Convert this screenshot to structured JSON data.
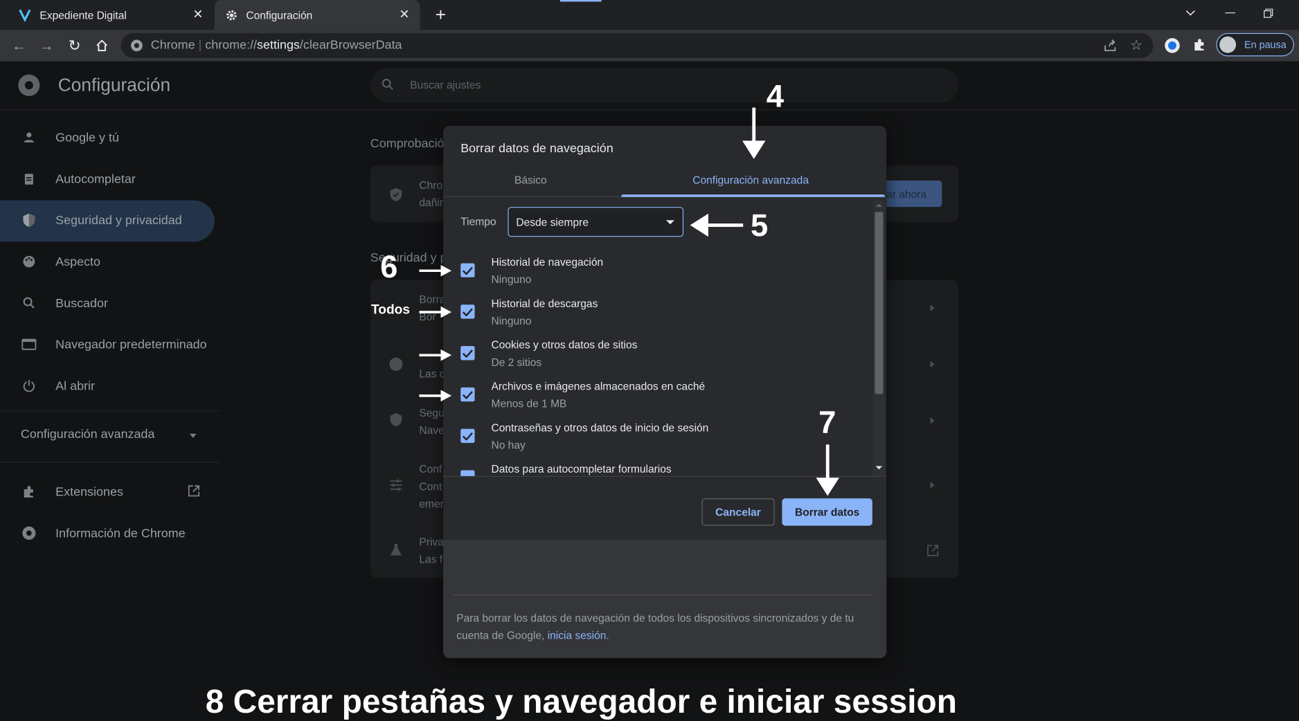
{
  "browser": {
    "tabs": [
      {
        "title": "Expediente Digital",
        "active": false
      },
      {
        "title": "Configuración",
        "active": true
      }
    ],
    "omnibox": {
      "scheme_label": "Chrome",
      "url_prefix": "chrome://",
      "url_host": "settings",
      "url_path": "/clearBrowserData"
    },
    "profile_label": "En pausa"
  },
  "settings": {
    "title": "Configuración",
    "search_placeholder": "Buscar ajustes",
    "nav": [
      {
        "label": "Google y tú",
        "icon": "person-icon"
      },
      {
        "label": "Autocompletar",
        "icon": "clipboard-icon"
      },
      {
        "label": "Seguridad y privacidad",
        "icon": "shield-icon",
        "active": true
      },
      {
        "label": "Aspecto",
        "icon": "palette-icon"
      },
      {
        "label": "Buscador",
        "icon": "search-icon"
      },
      {
        "label": "Navegador predeterminado",
        "icon": "browser-window-icon"
      },
      {
        "label": "Al abrir",
        "icon": "power-icon"
      }
    ],
    "advanced_label": "Configuración avanzada",
    "extensions_label": "Extensiones",
    "about_label": "Información de Chrome",
    "bg": {
      "safety_heading": "Comprobación",
      "safety_line1": "Chro",
      "safety_line2": "dañir",
      "check_now": "ar ahora",
      "privacy_heading": "Seguridad y p",
      "rows": [
        {
          "l1": "Borra",
          "l2": "Bor"
        },
        {
          "l1": "",
          "l2": "Las c"
        },
        {
          "l1": "Segu",
          "l2": "Nave"
        },
        {
          "l1": "Conf",
          "l2": "Cont",
          "l3": "emer"
        },
        {
          "l1": "Priva",
          "l2": "Las f"
        }
      ]
    }
  },
  "dialog": {
    "title": "Borrar datos de navegación",
    "tabs": [
      "Básico",
      "Configuración avanzada"
    ],
    "active_tab": "Configuración avanzada",
    "time_label": "Tiempo",
    "time_value": "Desde siempre",
    "items": [
      {
        "title": "Historial de navegación",
        "sub": "Ninguno",
        "checked": true
      },
      {
        "title": "Historial de descargas",
        "sub": "Ninguno",
        "checked": true
      },
      {
        "title": "Cookies y otros datos de sitios",
        "sub": "De 2 sitios",
        "checked": true
      },
      {
        "title": "Archivos e imágenes almacenados en caché",
        "sub": "Menos de 1 MB",
        "checked": true
      },
      {
        "title": "Contraseñas y otros datos de inicio de sesión",
        "sub": "No hay",
        "checked": true
      },
      {
        "title": "Datos para autocompletar formularios",
        "sub": "",
        "checked": true
      }
    ],
    "cancel_label": "Cancelar",
    "clear_label": "Borrar datos",
    "sync_text_before": "Para borrar los datos de navegación de todos los dispositivos sincronizados y de tu cuenta de Google,",
    "sync_link": "inicia sesión",
    "sync_text_after": "."
  },
  "annotations": {
    "step4": "4",
    "step5": "5",
    "step6": "6",
    "todos": "Todos",
    "step7": "7",
    "caption": "8 Cerrar  pestañas y navegador e iniciar session"
  }
}
